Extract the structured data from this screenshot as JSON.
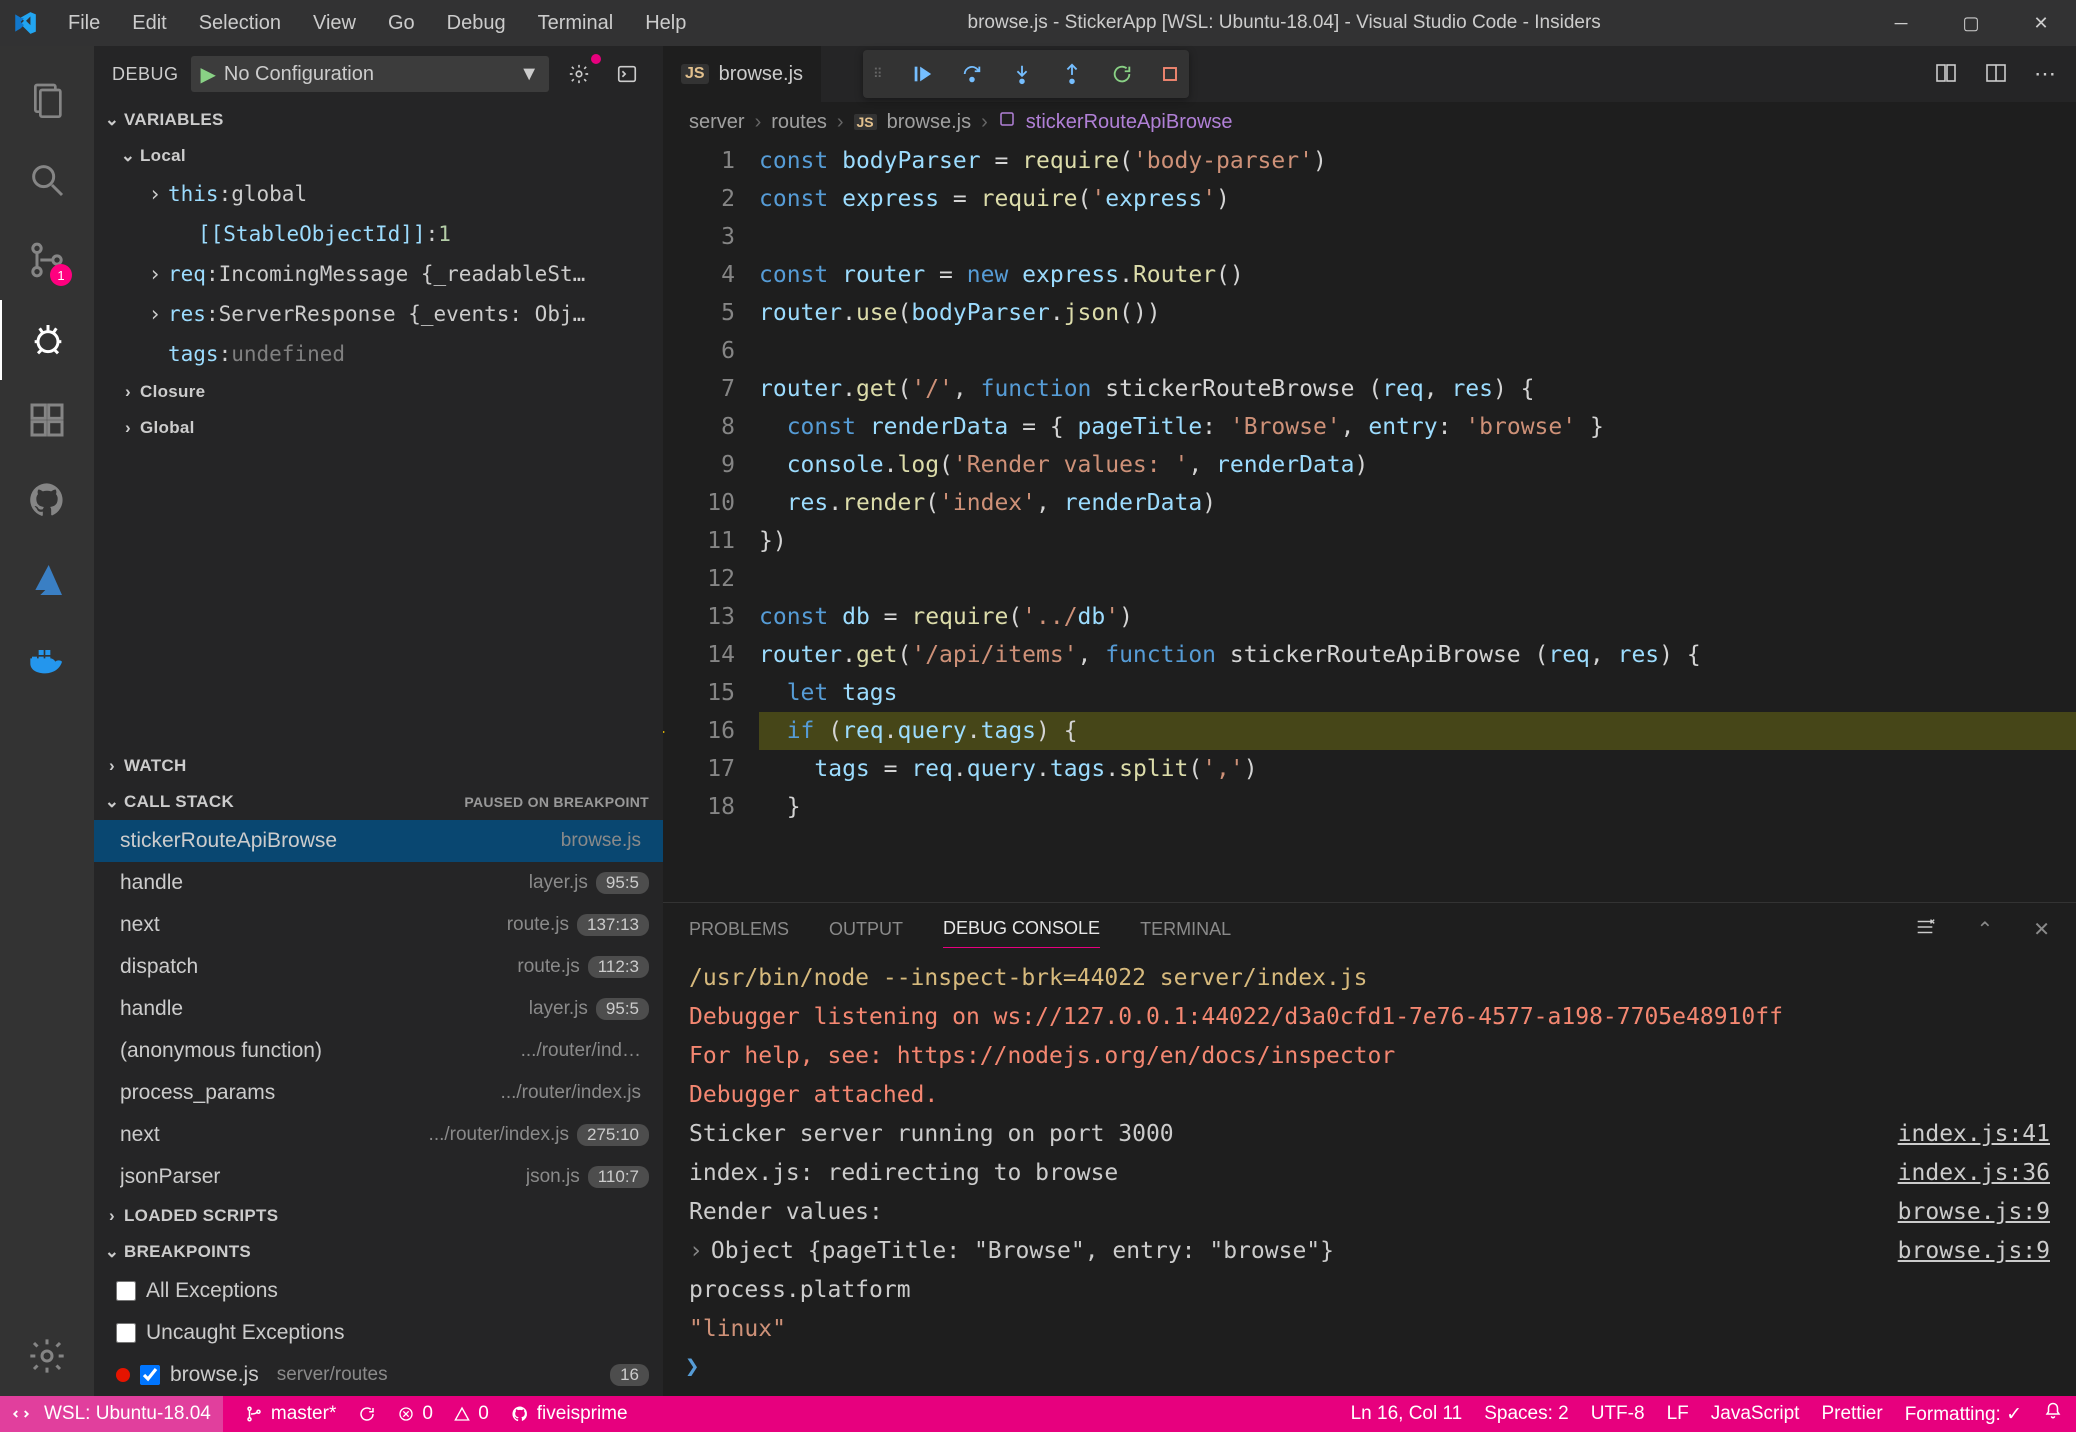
{
  "title": "browse.js - StickerApp [WSL: Ubuntu-18.04] - Visual Studio Code - Insiders",
  "menu": [
    "File",
    "Edit",
    "Selection",
    "View",
    "Go",
    "Debug",
    "Terminal",
    "Help"
  ],
  "activity_badge": "1",
  "debug": {
    "label": "DEBUG",
    "config": "No Configuration",
    "sections": {
      "variables": "VARIABLES",
      "watch": "WATCH",
      "callstack": "CALL STACK",
      "callstack_status": "PAUSED ON BREAKPOINT",
      "loaded": "LOADED SCRIPTS",
      "breakpoints": "BREAKPOINTS"
    },
    "scopes": {
      "local": "Local",
      "closure": "Closure",
      "global": "Global"
    },
    "locals": [
      {
        "k": "this",
        "v": "global",
        "expand": true
      },
      {
        "k": "[[StableObjectId]]",
        "v": "1",
        "num": true
      },
      {
        "k": "req",
        "v": "IncomingMessage {_readableSt…",
        "expand": true
      },
      {
        "k": "res",
        "v": "ServerResponse {_events: Obj…",
        "expand": true
      },
      {
        "k": "tags",
        "v": "undefined",
        "undef": true
      }
    ],
    "callstack": [
      {
        "fn": "stickerRouteApiBrowse",
        "file": "browse.js",
        "loc": "",
        "sel": true
      },
      {
        "fn": "handle",
        "file": "layer.js",
        "loc": "95:5"
      },
      {
        "fn": "next",
        "file": "route.js",
        "loc": "137:13"
      },
      {
        "fn": "dispatch",
        "file": "route.js",
        "loc": "112:3"
      },
      {
        "fn": "handle",
        "file": "layer.js",
        "loc": "95:5"
      },
      {
        "fn": "(anonymous function)",
        "file": ".../router/ind…",
        "loc": ""
      },
      {
        "fn": "process_params",
        "file": ".../router/index.js",
        "loc": ""
      },
      {
        "fn": "next",
        "file": ".../router/index.js",
        "loc": "275:10"
      },
      {
        "fn": "jsonParser",
        "file": "json.js",
        "loc": "110:7"
      }
    ],
    "breakpoints": {
      "all": "All Exceptions",
      "uncaught": "Uncaught Exceptions",
      "file": "browse.js",
      "path": "server/routes",
      "count": "16"
    }
  },
  "tab": {
    "icon": "JS",
    "name": "browse.js"
  },
  "breadcrumb": [
    "server",
    "routes",
    "browse.js",
    "stickerRouteApiBrowse"
  ],
  "editor": {
    "lines": [
      "const bodyParser = require('body-parser')",
      "const express = require('express')",
      "",
      "const router = new express.Router()",
      "router.use(bodyParser.json())",
      "",
      "router.get('/', function stickerRouteBrowse (req, res) {",
      "  const renderData = { pageTitle: 'Browse', entry: 'browse' }",
      "  console.log('Render values: ', renderData)",
      "  res.render('index', renderData)",
      "})",
      "",
      "const db = require('../db')",
      "router.get('/api/items', function stickerRouteApiBrowse (req, res) {",
      "  let tags",
      "  if (req.query.tags) {",
      "    tags = req.query.tags.split(',')",
      "  }"
    ],
    "current_line": 16
  },
  "panel": {
    "tabs": [
      "PROBLEMS",
      "OUTPUT",
      "DEBUG CONSOLE",
      "TERMINAL"
    ],
    "active": 2,
    "lines": [
      {
        "t": "/usr/bin/node --inspect-brk=44022 server/index.js",
        "cls": "warn"
      },
      {
        "t": "Debugger listening on ws://127.0.0.1:44022/d3a0cfd1-7e76-4577-a198-7705e48910ff",
        "cls": "err"
      },
      {
        "t": "For help, see: https://nodejs.org/en/docs/inspector",
        "cls": "err"
      },
      {
        "t": "Debugger attached.",
        "cls": "err"
      },
      {
        "t": "Sticker server running on port 3000",
        "loc": "index.js:41"
      },
      {
        "t": "index.js: redirecting to browse",
        "loc": "index.js:36"
      },
      {
        "t": "Render values: ",
        "loc": "browse.js:9"
      },
      {
        "t": "Object {pageTitle: \"Browse\", entry: \"browse\"}",
        "loc": "browse.js:9",
        "exp": true
      },
      {
        "t": "process.platform"
      },
      {
        "t": "\"linux\"",
        "cls": "str"
      }
    ],
    "prompt": "❯"
  },
  "status": {
    "wsl": "WSL: Ubuntu-18.04",
    "branch": "master*",
    "errors": "0",
    "warnings": "0",
    "gh": "fiveisprime",
    "pos": "Ln 16, Col 11",
    "spaces": "Spaces: 2",
    "enc": "UTF-8",
    "eol": "LF",
    "lang": "JavaScript",
    "prettier": "Prettier",
    "fmt": "Formatting: ✓"
  }
}
